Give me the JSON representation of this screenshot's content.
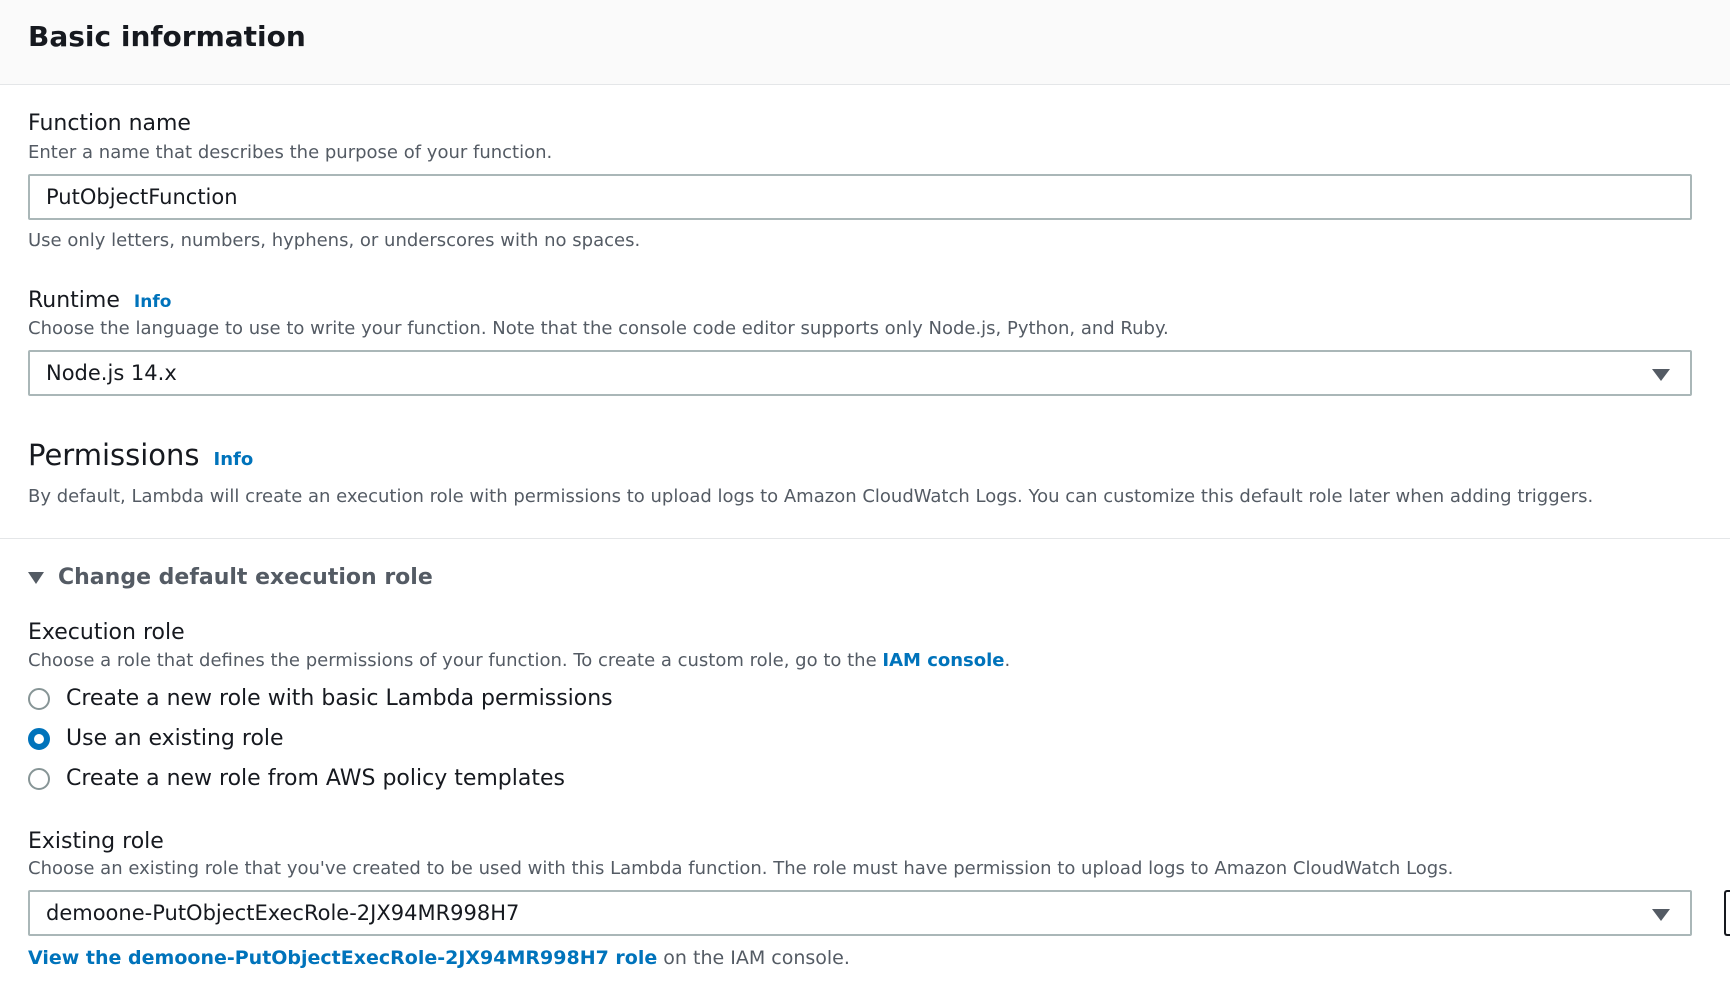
{
  "header": {
    "title": "Basic information"
  },
  "function_name": {
    "label": "Function name",
    "description": "Enter a name that describes the purpose of your function.",
    "value": "PutObjectFunction",
    "hint": "Use only letters, numbers, hyphens, or underscores with no spaces."
  },
  "runtime": {
    "label": "Runtime",
    "info": "Info",
    "description": "Choose the language to use to write your function. Note that the console code editor supports only Node.js, Python, and Ruby.",
    "selected": "Node.js 14.x"
  },
  "permissions": {
    "title": "Permissions",
    "info": "Info",
    "description": "By default, Lambda will create an execution role with permissions to upload logs to Amazon CloudWatch Logs. You can customize this default role later when adding triggers."
  },
  "change_role": {
    "label": "Change default execution role"
  },
  "execution_role": {
    "label": "Execution role",
    "description_prefix": "Choose a role that defines the permissions of your function. To create a custom role, go to the ",
    "description_link": "IAM console",
    "description_suffix": ".",
    "options": [
      {
        "label": "Create a new role with basic Lambda permissions",
        "checked": false
      },
      {
        "label": "Use an existing role",
        "checked": true
      },
      {
        "label": "Create a new role from AWS policy templates",
        "checked": false
      }
    ]
  },
  "existing_role": {
    "label": "Existing role",
    "description": "Choose an existing role that you've created to be used with this Lambda function. The role must have permission to upload logs to Amazon CloudWatch Logs.",
    "selected": "demoone-PutObjectExecRole-2JX94MR998H7",
    "view_link": "View the demoone-PutObjectExecRole-2JX94MR998H7 role",
    "view_suffix": " on the IAM console."
  },
  "colors": {
    "accent": "#0073bb",
    "text": "#16191f",
    "secondary": "#545b64",
    "border": "#aab7b8"
  }
}
